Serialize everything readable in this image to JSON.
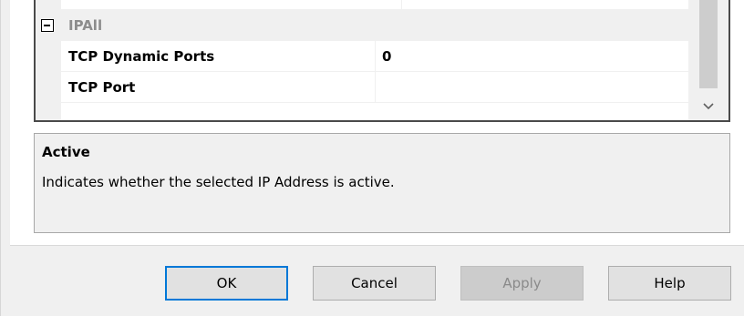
{
  "property_grid": {
    "category": {
      "label": "IPAll",
      "expanded": true
    },
    "rows": [
      {
        "name": "TCP Dynamic Ports",
        "value": "0"
      },
      {
        "name": "TCP Port",
        "value": ""
      }
    ]
  },
  "description": {
    "title": "Active",
    "text": "Indicates whether the selected IP Address is active."
  },
  "buttons": {
    "ok": "OK",
    "cancel": "Cancel",
    "apply": "Apply",
    "help": "Help"
  },
  "icons": {
    "collapse": "collapse-minus-icon",
    "scroll_down": "chevron-down-icon"
  },
  "colors": {
    "focus_border": "#0078d7",
    "category_text": "#8d8d8d",
    "disabled_text": "#8a8a8a",
    "scroll_thumb": "#cdcdcd"
  }
}
